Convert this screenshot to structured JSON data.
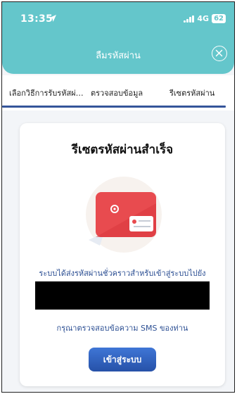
{
  "status_bar": {
    "time": "13:35",
    "network": "4G",
    "battery": "62"
  },
  "header": {
    "title": "ลืมรหัสผ่าน"
  },
  "tabs": [
    {
      "label": "เลือกวิธีการรับรหัสผ่าน"
    },
    {
      "label": "ตรวจสอบข้อมูล"
    },
    {
      "label": "รีเซตรหัสผ่าน"
    }
  ],
  "active_tab": 2,
  "card": {
    "title": "รีเซตรหัสผ่านสำเร็จ",
    "message": "ระบบได้ส่งรหัสผ่านชั่วคราวสำหรับเข้าสู่ระบบไปยัง",
    "hint": "กรุณาตรวจสอบข้อความ SMS ของท่าน",
    "button_label": "เข้าสู่ระบบ"
  },
  "colors": {
    "header": "#64c6cb",
    "accent": "#34549a",
    "button": "#2f5fbf",
    "envelope": "#e84b4f"
  },
  "icons": [
    "location-arrow-icon",
    "signal-icon",
    "battery-icon",
    "close-icon",
    "envelope-icon"
  ]
}
